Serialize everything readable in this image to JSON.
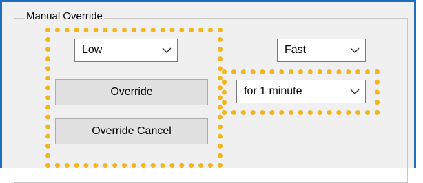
{
  "group": {
    "title": "Manual Override"
  },
  "mode_select": {
    "value": "Low",
    "icon": "chevron-down-icon"
  },
  "speed_select": {
    "value": "Fast",
    "icon": "chevron-down-icon"
  },
  "duration_select": {
    "value": "for 1 minute",
    "icon": "chevron-down-icon"
  },
  "buttons": {
    "override_label": "Override",
    "override_cancel_label": "Override Cancel"
  },
  "colors": {
    "highlight": "#f3b51d",
    "window_border": "#1f6fbf",
    "panel_background": "#f0f0f0"
  }
}
